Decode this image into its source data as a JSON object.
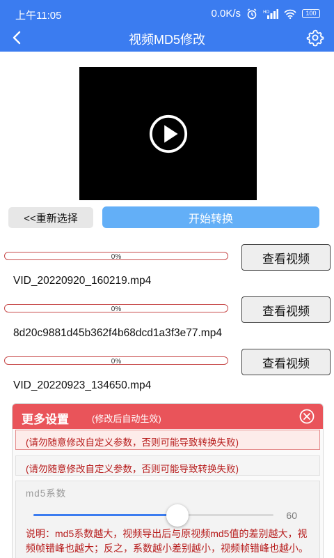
{
  "status_bar": {
    "time": "上午11:05",
    "network_speed": "0.0K/s",
    "battery": "100"
  },
  "app_bar": {
    "title": "视频MD5修改"
  },
  "actions": {
    "reselect_label": "<<重新选择",
    "start_label": "开始转换"
  },
  "files": [
    {
      "progress_text": "0%",
      "progress": 0,
      "view_label": "查看视频",
      "name": "VID_20220920_160219.mp4"
    },
    {
      "progress_text": "0%",
      "progress": 0,
      "view_label": "查看视频",
      "name": "8d20c9881d45b362f4b68dcd1a3f3e77.mp4"
    },
    {
      "progress_text": "0%",
      "progress": 0,
      "view_label": "查看视频",
      "name": "VID_20220923_134650.mp4"
    }
  ],
  "settings": {
    "title": "更多设置",
    "subtitle": "(修改后自动生效)",
    "warning_1": "(请勿随意修改自定义参数，否则可能导致转换失败)",
    "warning_2": "(请勿随意修改自定义参数，否则可能导致转换失败)",
    "md5_label": "md5系数",
    "md5_value": "60",
    "md5_fraction": 0.6,
    "description": "说明：md5系数越大，视频导出后与原视频md5值的差别越大，视频帧错峰也越大；反之，系数越小差别越小，视频帧错峰也越小。"
  },
  "colors": {
    "primary": "#3b7cf0",
    "start_button": "#63aff7",
    "header_red": "#e9545a",
    "warning_text": "#b71c1c"
  }
}
